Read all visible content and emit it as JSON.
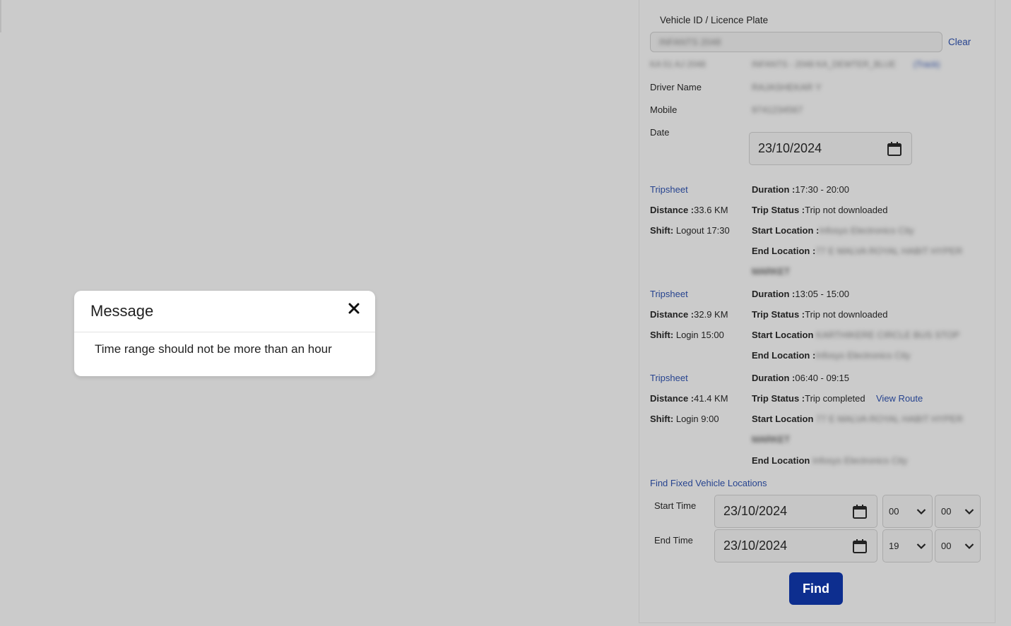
{
  "vehicle": {
    "label": "Vehicle ID / Licence Plate",
    "input_value": "INFANTS 2048",
    "clear_label": "Clear",
    "id_row_label": "KA 51 AJ 2048",
    "id_row_value": "INFANTS - 2048 KA_DEWTER_BLUE",
    "track_link": "(Track)"
  },
  "driver": {
    "label": "Driver Name",
    "value": "RAJASHEKAR Y"
  },
  "mobile": {
    "label": "Mobile",
    "value": "9741234567"
  },
  "date": {
    "label": "Date",
    "value": "23/10/2024"
  },
  "trips": [
    {
      "tripsheet": "Tripsheet",
      "duration_label": "Duration :",
      "duration_value": "17:30 - 20:00",
      "distance_label": "Distance :",
      "distance_value": "33.6 KM",
      "status_label": "Trip Status :",
      "status_value": "Trip not downloaded",
      "shift_label": "Shift:",
      "shift_value": "Logout 17:30",
      "start_label": "Start Location :",
      "start_value": "Infosys Electronics City",
      "end_label": "End Location :",
      "end_value_1": "77 E MALVA ROYAL HABIT HYPER",
      "end_value_2": "MARKET"
    },
    {
      "tripsheet": "Tripsheet",
      "duration_label": "Duration :",
      "duration_value": "13:05 - 15:00",
      "distance_label": "Distance :",
      "distance_value": "32.9 KM",
      "status_label": "Trip Status :",
      "status_value": "Trip not downloaded",
      "shift_label": "Shift:",
      "shift_value": "Login 15:00",
      "start_label": "Start Location",
      "start_value": "KARTHIKERE CIRCLE BUS STOP",
      "end_label": "End Location :",
      "end_value": "Infosys Electronics City"
    },
    {
      "tripsheet": "Tripsheet",
      "duration_label": "Duration :",
      "duration_value": "06:40 - 09:15",
      "distance_label": "Distance :",
      "distance_value": "41.4 KM",
      "status_label": "Trip Status :",
      "status_value": "Trip completed",
      "view_route": "View Route",
      "shift_label": "Shift:",
      "shift_value": "Login 9:00",
      "start_label": "Start Location",
      "start_value_1": "77 E MALVA ROYAL HABIT HYPER",
      "start_value_2": "MARKET",
      "end_label": "End Location",
      "end_value": "Infosys Electronics City"
    }
  ],
  "fixed": {
    "link": "Find Fixed Vehicle Locations",
    "start_label": "Start Time",
    "start_date": "23/10/2024",
    "start_hour": "00",
    "start_min": "00",
    "end_label": "End Time",
    "end_date": "23/10/2024",
    "end_hour": "19",
    "end_min": "00",
    "find_label": "Find"
  },
  "modal": {
    "title": "Message",
    "body": "Time range should not be more than an hour"
  },
  "colors": {
    "background": "#cbcbcb",
    "link": "#26438f",
    "primary_button": "#0d2e8f",
    "modal_bg": "#ffffff"
  }
}
